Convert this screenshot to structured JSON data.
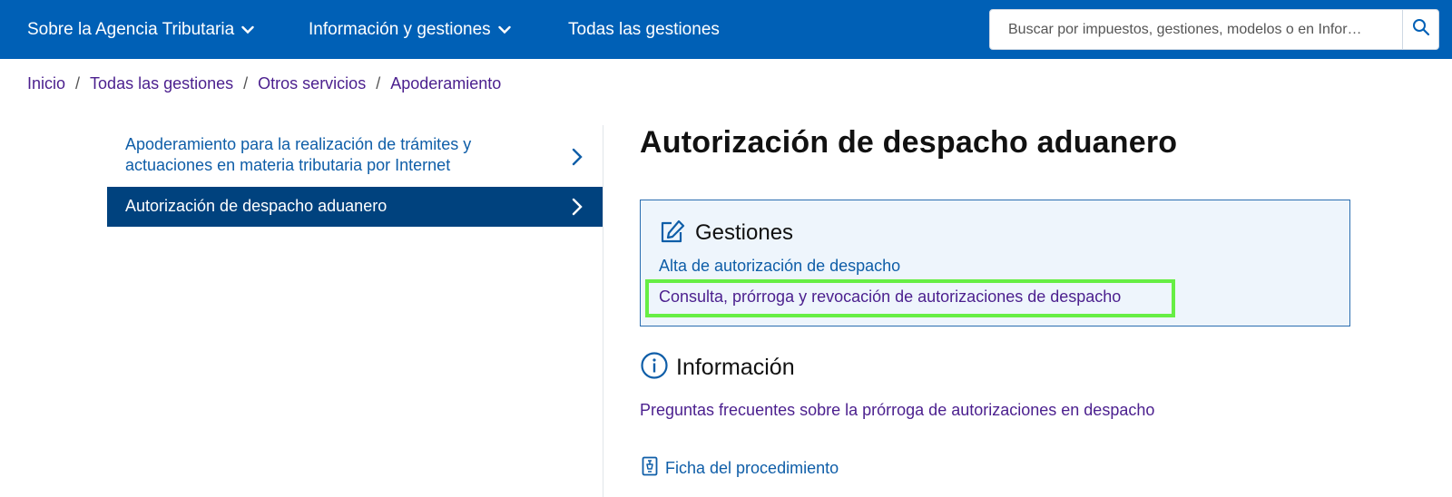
{
  "header": {
    "nav": [
      {
        "label": "Sobre la Agencia Tributaria",
        "has_dropdown": true
      },
      {
        "label": "Información y gestiones",
        "has_dropdown": true
      },
      {
        "label": "Todas las gestiones",
        "has_dropdown": false
      }
    ],
    "search": {
      "placeholder": "Buscar por impuestos, gestiones, modelos o en Infor…",
      "value": ""
    },
    "colors": {
      "bar": "#0060b6",
      "text": "#ffffff"
    }
  },
  "breadcrumb": [
    "Inicio",
    "Todas las gestiones",
    "Otros servicios",
    "Apoderamiento"
  ],
  "breadcrumb_separator": "/",
  "sidebar": {
    "items": [
      {
        "label": "Apoderamiento para la realización de trámites y actuaciones en materia tributaria por Internet",
        "active": false
      },
      {
        "label": "Autorización de despacho aduanero",
        "active": true
      }
    ]
  },
  "main": {
    "title": "Autorización de despacho aduanero",
    "gestiones": {
      "heading": "Gestiones",
      "icon": "edit-icon",
      "links": [
        {
          "label": "Alta de autorización de despacho"
        },
        {
          "label": "Consulta, prórroga y revocación de autorizaciones de despacho",
          "highlighted": true
        }
      ]
    },
    "informacion": {
      "heading": "Información",
      "icon": "info-icon",
      "links": [
        {
          "label": "Preguntas frecuentes sobre la prórroga de autorizaciones en despacho"
        }
      ]
    },
    "ficha": {
      "label": "Ficha del procedimiento",
      "icon": "document-icon"
    }
  },
  "accent_colors": {
    "link_blue": "#0f5ea8",
    "link_visited": "#4b1f8e",
    "active_item": "#00427e",
    "highlight": "#66ee44"
  }
}
